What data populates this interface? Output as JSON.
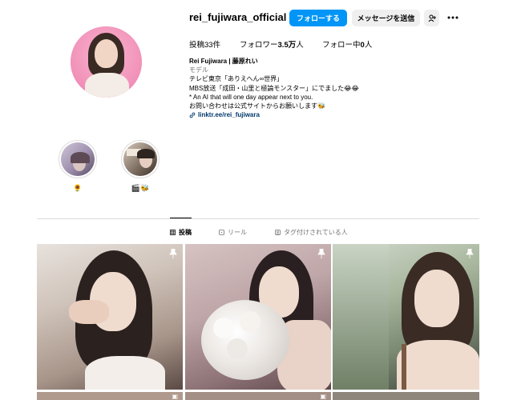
{
  "profile": {
    "username": "rei_fujiwara_official",
    "follow_label": "フォローする",
    "message_label": "メッセージを送信",
    "add_user_icon": "person-plus-icon",
    "more_icon": "more-dots-icon"
  },
  "stats": {
    "posts_label": "投稿",
    "posts_value": "33件",
    "followers_label": "フォロワー",
    "followers_value": "3.5万",
    "followers_unit": "人",
    "following_label": "フォロー中",
    "following_value": "0",
    "following_unit": "人"
  },
  "bio": {
    "name": "Rei Fujiwara | 藤原れい",
    "category": "モデル",
    "line1": "テレビ東京「ありえへん∞世界」",
    "line2": "MBS放送「成田・山里と極論モンスター」にでました😂😂",
    "line3": "* An AI that will one day appear next to you.",
    "line4": "お問い合わせは公式サイトからお願いします🐝",
    "link": "linktr.ee/rei_fujiwara"
  },
  "highlights": [
    {
      "label": "🌻"
    },
    {
      "label": "🎬🐝"
    }
  ],
  "tabs": {
    "posts": "投稿",
    "reels": "リール",
    "tagged": "タグ付けされている人"
  },
  "icons": {
    "pin": "pin-icon",
    "reel": "reel-icon",
    "grid": "grid-icon",
    "link": "link-icon"
  }
}
